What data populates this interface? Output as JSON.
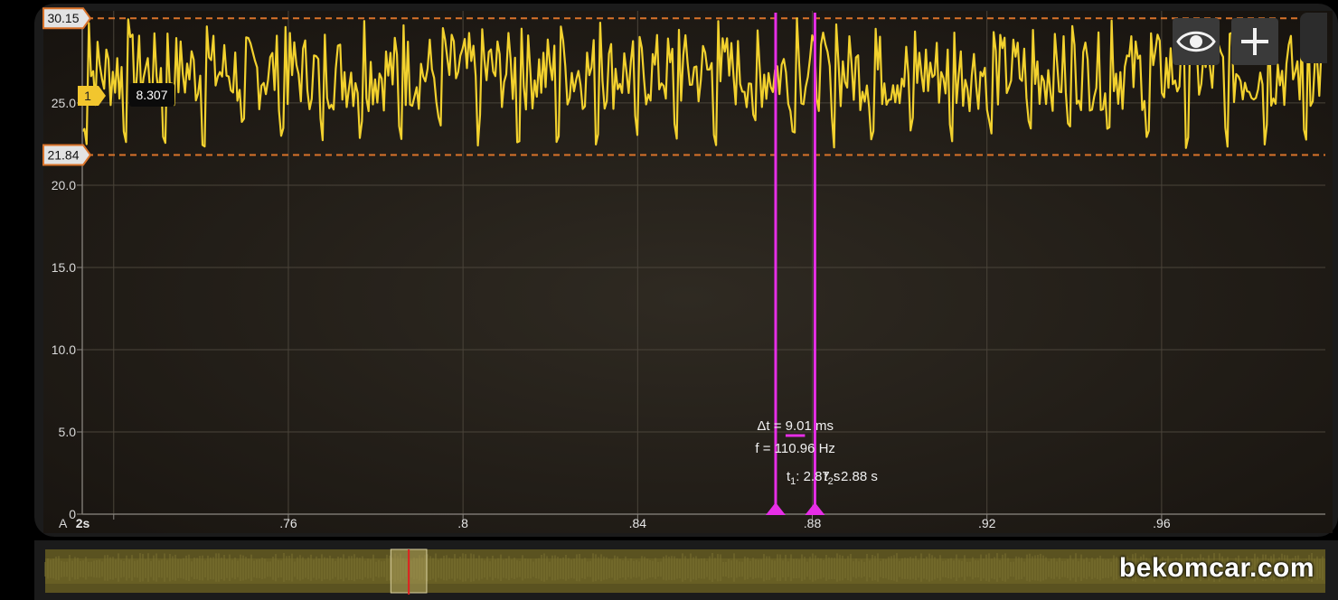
{
  "chart_data": {
    "type": "line",
    "title": "",
    "channel_label": "A",
    "channel_marker": "1",
    "marker_value": "8.307",
    "xlabel": "",
    "ylabel": "",
    "x_ticks": [
      {
        "value": 0.72,
        "label": "2s"
      },
      {
        "value": 0.76,
        "label": ".76"
      },
      {
        "value": 0.8,
        "label": ".8"
      },
      {
        "value": 0.84,
        "label": ".84"
      },
      {
        "value": 0.88,
        "label": ".88"
      },
      {
        "value": 0.92,
        "label": ".92"
      },
      {
        "value": 0.96,
        "label": ".96"
      }
    ],
    "y_ticks": [
      {
        "value": 0,
        "label": "0"
      },
      {
        "value": 5,
        "label": "5.0"
      },
      {
        "value": 10,
        "label": "10.0"
      },
      {
        "value": 15,
        "label": "15.0"
      },
      {
        "value": 20,
        "label": "20.0"
      },
      {
        "value": 25,
        "label": "25.0"
      }
    ],
    "xlim": [
      0.7128,
      0.9975
    ],
    "ylim": [
      0,
      30.6
    ],
    "grid": true,
    "levels": [
      {
        "value": 30.15,
        "label": "30.15"
      },
      {
        "value": 21.84,
        "label": "21.84"
      }
    ],
    "signal": {
      "name": "",
      "color": "#f2d12e",
      "min": 21.84,
      "max": 30.15,
      "period_ms": 9.01
    },
    "cursors": {
      "t1": 0.8716,
      "t2": 0.8806,
      "color": "#e62ee6",
      "delta_text": "Δt = 9.01 ms",
      "freq_text": "f = 110.96 Hz",
      "t1_text": "t",
      "t1_sub": "1",
      "t1_value": ": 2.87 s",
      "t2_text": "t",
      "t2_sub": "2",
      "t2_value": ": 2.88 s"
    }
  },
  "overview": {
    "window_start": 0.27,
    "window_end": 0.298,
    "playhead": 0.284
  },
  "toolbar": {
    "eye_icon": "eye-icon",
    "plus_icon": "plus-icon"
  },
  "watermark": "bekomcar.com"
}
